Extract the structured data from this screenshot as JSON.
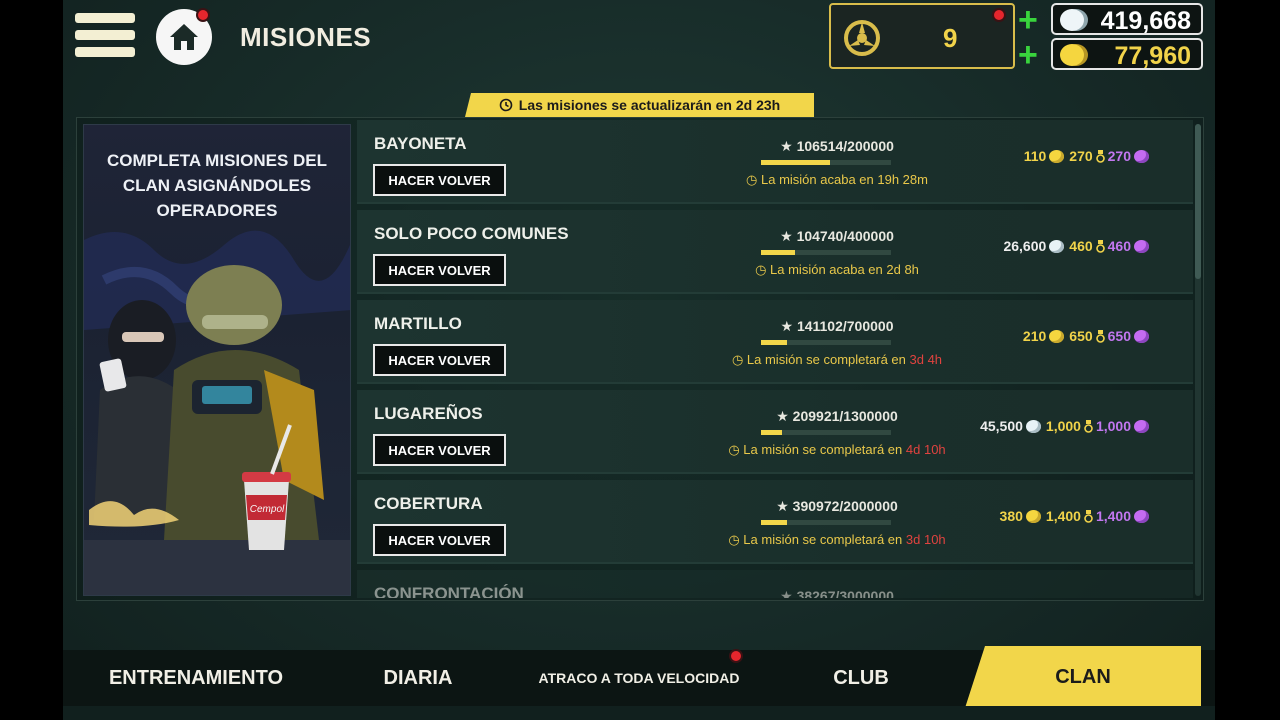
{
  "header": {
    "title": "MISIONES",
    "clan_points": "9",
    "silver": "419,668",
    "gold": "77,960"
  },
  "banner": {
    "text": "Las misiones se actualizarán en 2d 23h"
  },
  "art": {
    "title": "COMPLETA MISIONES DEL CLAN ASIGNÁNDOLES OPERADORES",
    "cup_brand": "Cempol"
  },
  "missions": [
    {
      "name": "BAYONETA",
      "button": "HACER VOLVER",
      "progress": "106514/200000",
      "fraction": 0.53,
      "status": "La misión acaba en 19h 28m",
      "status_red": "",
      "r1": "110",
      "r1_type": "gold",
      "r2": "270",
      "r3": "270"
    },
    {
      "name": "SOLO POCO COMUNES",
      "button": "HACER VOLVER",
      "progress": "104740/400000",
      "fraction": 0.26,
      "status": "La misión acaba en 2d 8h",
      "status_red": "",
      "r1": "26,600",
      "r1_type": "white",
      "r2": "460",
      "r3": "460"
    },
    {
      "name": "MARTILLO",
      "button": "HACER VOLVER",
      "progress": "141102/700000",
      "fraction": 0.2,
      "status": "La misión se completará en ",
      "status_red": "3d 4h",
      "r1": "210",
      "r1_type": "gold",
      "r2": "650",
      "r3": "650"
    },
    {
      "name": "LUGAREÑOS",
      "button": "HACER VOLVER",
      "progress": "209921/1300000",
      "fraction": 0.16,
      "status": "La misión se completará en ",
      "status_red": "4d 10h",
      "r1": "45,500",
      "r1_type": "white",
      "r2": "1,000",
      "r3": "1,000"
    },
    {
      "name": "COBERTURA",
      "button": "HACER VOLVER",
      "progress": "390972/2000000",
      "fraction": 0.2,
      "status": "La misión se completará en ",
      "status_red": "3d 10h",
      "r1": "380",
      "r1_type": "gold",
      "r2": "1,400",
      "r3": "1,400"
    },
    {
      "name": "CONFRONTACIÓN",
      "progress": "38267/3000000"
    }
  ],
  "tabs": [
    "ENTRENAMIENTO",
    "DIARIA",
    "ATRACO A TODA VELOCIDAD",
    "CLUB",
    "CLAN"
  ],
  "active_tab": "CLAN",
  "colors": {
    "accent": "#f2d64a",
    "plus": "#39d43d",
    "purple": "#c277f0",
    "notification": "#e5262d"
  }
}
